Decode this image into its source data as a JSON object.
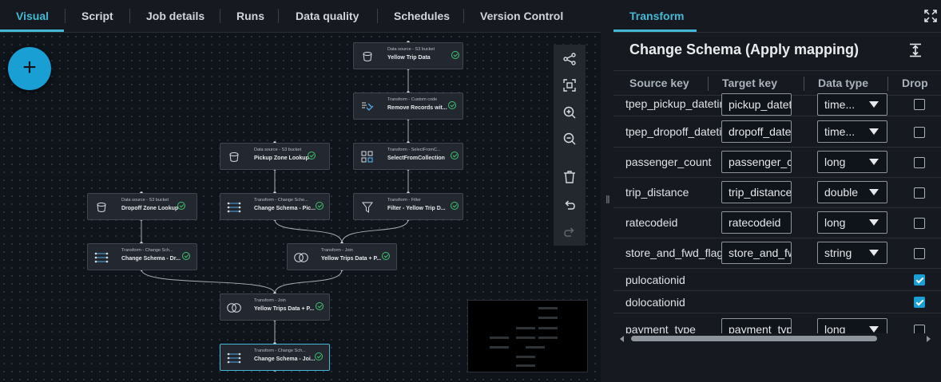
{
  "tabs": [
    {
      "label": "Visual",
      "active": true
    },
    {
      "label": "Script"
    },
    {
      "label": "Job details"
    },
    {
      "label": "Runs"
    },
    {
      "label": "Data quality"
    },
    {
      "label": "Schedules"
    },
    {
      "label": "Version Control"
    }
  ],
  "canvas": {
    "add_label": "+",
    "nodes": {
      "yellow": {
        "type": "Data source - S3 bucket",
        "name": "Yellow Trip Data",
        "icon": "bucket-icon"
      },
      "remove": {
        "type": "Transform - Custom code",
        "name": "Remove Records wit...",
        "icon": "custom-code-icon"
      },
      "pickup": {
        "type": "Data source - S3 bucket",
        "name": "Pickup Zone Lookup",
        "icon": "bucket-icon"
      },
      "select": {
        "type": "Transform - SelectFromC...",
        "name": "SelectFromCollection",
        "icon": "select-collection-icon"
      },
      "dropoff": {
        "type": "Data source - S3 bucket",
        "name": "Dropoff Zone Lookup",
        "icon": "bucket-icon"
      },
      "changepick": {
        "type": "Transform - Change Sche...",
        "name": "Change Schema - Pic...",
        "icon": "mapping-icon"
      },
      "filter": {
        "type": "Transform - Filter",
        "name": "Filter - Yellow Trip D...",
        "icon": "filter-icon"
      },
      "changedrop": {
        "type": "Transform - Change Sch...",
        "name": "Change Schema - Dr...",
        "icon": "mapping-icon"
      },
      "join1": {
        "type": "Transform - Join",
        "name": "Yellow Trips Data + P...",
        "icon": "join-icon"
      },
      "join2": {
        "type": "Transform - Join",
        "name": "Yellow Trips Data + P...",
        "icon": "join-icon"
      },
      "changejoined": {
        "type": "Transform - Change Sch...",
        "name": "Change Schema - Joi...",
        "icon": "mapping-icon"
      }
    },
    "toolbar_icons": [
      "layout-icon",
      "fit-view-icon",
      "zoom-in-icon",
      "zoom-out-icon",
      "delete-icon",
      "undo-icon",
      "redo-icon"
    ]
  },
  "panel": {
    "tab": "Transform",
    "title": "Change Schema (Apply mapping)",
    "columns": [
      "Source key",
      "Target key",
      "Data type",
      "Drop"
    ],
    "rows": [
      {
        "source": "tpep_pickup_datetime",
        "target": "pickup_datetime",
        "type": "time...",
        "drop": false
      },
      {
        "source": "tpep_dropoff_datetime",
        "target": "dropoff_datetime",
        "type": "time...",
        "drop": false
      },
      {
        "source": "passenger_count",
        "target": "passenger_count",
        "type": "long",
        "drop": false
      },
      {
        "source": "trip_distance",
        "target": "trip_distance",
        "type": "double",
        "drop": false
      },
      {
        "source": "ratecodeid",
        "target": "ratecodeid",
        "type": "long",
        "drop": false
      },
      {
        "source": "store_and_fwd_flag",
        "target": "store_and_fwd_flag",
        "type": "string",
        "drop": false
      },
      {
        "source": "pulocationid",
        "drop": true
      },
      {
        "source": "dolocationid",
        "drop": true
      },
      {
        "source": "payment_type",
        "target": "payment_type",
        "type": "long",
        "drop": false
      }
    ]
  },
  "colors": {
    "accent": "#44b9d6",
    "add_button": "#1a9fd4",
    "status_ok": "#3ec46d"
  }
}
